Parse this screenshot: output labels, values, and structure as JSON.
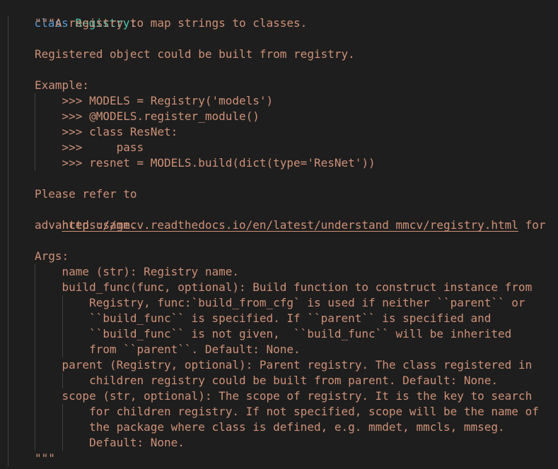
{
  "code": {
    "keyword": "class",
    "class_name": "Registry",
    "colon": ":",
    "docstring_lines": [
      "\"\"\"A registry to map strings to classes.",
      "",
      "Registered object could be built from registry.",
      "",
      "Example:",
      "    >>> MODELS = Registry('models')",
      "    >>> @MODELS.register_module()",
      "    >>> class ResNet:",
      "    >>>     pass",
      "    >>> resnet = MODELS.build(dict(type='ResNet'))",
      "",
      "Please refer to",
      "",
      "advanced usage.",
      "",
      "Args:",
      "    name (str): Registry name.",
      "    build_func(func, optional): Build function to construct instance from",
      "        Registry, func:`build_from_cfg` is used if neither ``parent`` or",
      "        ``build_func`` is specified. If ``parent`` is specified and",
      "        ``build_func`` is not given,  ``build_func`` will be inherited",
      "        from ``parent``. Default: None.",
      "    parent (Registry, optional): Parent registry. The class registered in",
      "        children registry could be built from parent. Default: None.",
      "    scope (str, optional): The scope of registry. It is the key to search",
      "        for children registry. If not specified, scope will be the name of",
      "        the package where class is defined, e.g. mmdet, mmcls, mmseg.",
      "        Default: None.",
      "\"\"\""
    ],
    "link_url": "https://mmcv.readthedocs.io/en/latest/understand_mmcv/registry.html",
    "link_suffix": " for"
  },
  "colors": {
    "background": "#1e1e1e",
    "keyword": "#569cd6",
    "class_name": "#4ec9b0",
    "string": "#ce9178",
    "punctuation": "#d4d4d4"
  }
}
